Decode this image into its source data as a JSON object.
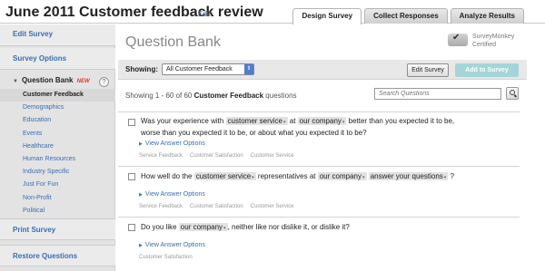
{
  "header": {
    "title": "June 2011 Customer feedback review",
    "edit_link": "Edit",
    "tabs": [
      "Design Survey",
      "Collect Responses",
      "Analyze Results"
    ]
  },
  "sidebar": {
    "edit_survey": "Edit Survey",
    "survey_options": "Survey Options",
    "question_bank": "Question Bank",
    "new_badge": "NEW",
    "help": "?",
    "categories": [
      "Customer Feedback",
      "Demographics",
      "Education",
      "Events",
      "Healthcare",
      "Human Resources",
      "Industry Specific",
      "Just For Fun",
      "Non-Profit",
      "Political"
    ],
    "active_category": "Customer Feedback",
    "print_survey": "Print Survey",
    "restore_questions": "Restore Questions"
  },
  "main": {
    "page_title": "Question Bank",
    "certified_line1": "SurveyMonkey",
    "certified_line2": "Certified",
    "show_label": "Showing:",
    "show_select_value": "All Customer Feedback",
    "edit_survey_button": "Edit Survey",
    "add_to_survey_button": "Add to Survey",
    "showing_prefix": "Showing 1 - 60 of 60 ",
    "showing_category": "Customer Feedback",
    "showing_suffix": " questions",
    "search_placeholder": "Search Questions",
    "view_answer_options": "View Answer Options",
    "questions": [
      {
        "line1_a": "Was your experience with ",
        "tok1": "customer service",
        "line1_b": " at ",
        "tok2": "our company",
        "line1_c": " better than you expected it to be,",
        "line2": "worse than you expected it to be, or about what you expected it to be?",
        "tags": [
          "Service Feedback",
          "Customer Satisfaction",
          "Customer Service"
        ]
      },
      {
        "line1_a": "How well do the ",
        "tok1": "customer service",
        "line1_b": " representatives at ",
        "tok2": "our company",
        "tok3": "answer your questions",
        "line1_c": " ?",
        "tags": [
          "Service Feedback",
          "Customer Satisfaction",
          "Customer Service"
        ]
      },
      {
        "line1_a": "Do you like ",
        "tok1": "our company",
        "line1_b": ", neither like nor dislike it, or dislike it?",
        "tags": [
          "Customer Satisfaction"
        ]
      }
    ]
  },
  "colors": {
    "link": "#3a6fb0",
    "new_badge": "#d23c2a",
    "add_button": "#a4d5d8",
    "select_arrow": "#4b7fd6"
  }
}
